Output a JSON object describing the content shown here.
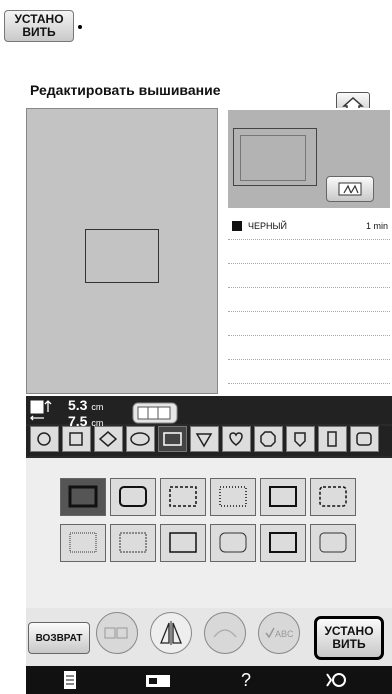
{
  "top": {
    "set_label": "УСТАНО\nВИТЬ"
  },
  "header": {
    "title": "Редактировать вышивание"
  },
  "preview": {
    "color_rows": [
      {
        "name": "ЧЕРНЫЙ",
        "time": "1 min"
      },
      {
        "name": "",
        "time": ""
      },
      {
        "name": "",
        "time": ""
      },
      {
        "name": "",
        "time": ""
      },
      {
        "name": "",
        "time": ""
      },
      {
        "name": "",
        "time": ""
      },
      {
        "name": "",
        "time": ""
      }
    ]
  },
  "size": {
    "width_value": "5.3",
    "width_unit": "cm",
    "height_value": "7.5",
    "height_unit": "cm"
  },
  "shapes": {
    "count": 11
  },
  "frames": {
    "rows": 2,
    "cols": 6
  },
  "bottom": {
    "back_label": "ВОЗВРАТ",
    "set_label": "УСТАНО\nВИТЬ"
  },
  "nav": {
    "help_label": "?"
  }
}
